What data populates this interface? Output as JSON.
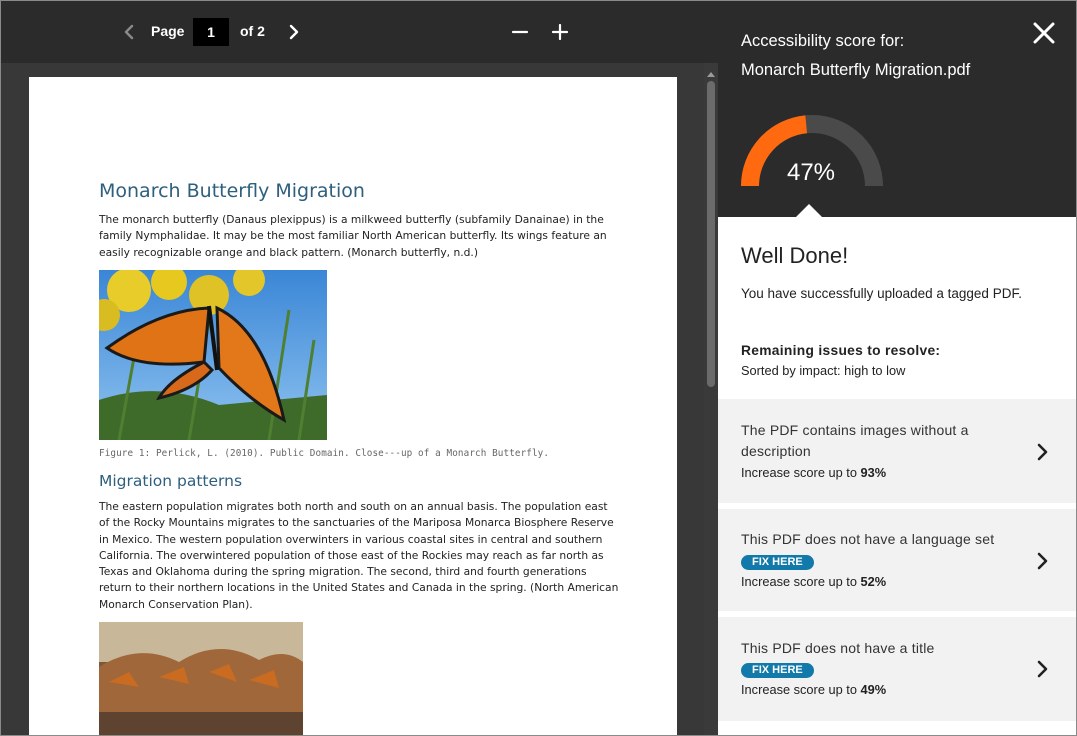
{
  "toolbar": {
    "page_label": "Page",
    "page_value": "1",
    "of_label": "of 2"
  },
  "document": {
    "title": "Monarch Butterfly Migration",
    "para1": "The monarch butterfly (Danaus plexippus) is a milkweed butterfly (subfamily Danainae) in the family Nymphalidae. It may be the most familiar North American butterfly. Its wings feature an easily recognizable orange and black pattern. (Monarch  butterfly, n.d.)",
    "caption": "Figure 1: Perlick, L. (2010). Public Domain. Close---up of a Monarch Butterfly.",
    "heading2": "Migration patterns",
    "para2": "The eastern population migrates both north and south on an annual basis. The population east of the Rocky Mountains migrates to the sanctuaries of the Mariposa Monarca Biosphere Reserve in Mexico. The western population overwinters in various coastal sites in central and southern California. The overwintered population of those east of the Rockies may reach as far north as Texas and Oklahoma during the spring migration. The second, third and fourth generations return to their northern locations in the United States and Canada in the spring.  (North American Monarch Conservation Plan)."
  },
  "panel": {
    "score_label": "Accessibility score for:",
    "file_name": "Monarch Butterfly Migration.pdf",
    "score_percent": 47,
    "score_text": "47%",
    "heading": "Well Done!",
    "message": "You have successfully uploaded a tagged PDF.",
    "remaining_label": "Remaining issues to resolve:",
    "sorted_label": "Sorted by impact: high to low",
    "issues": [
      {
        "title": "The PDF contains images without a description",
        "score_prefix": "Increase score up to",
        "score_value": "93%"
      },
      {
        "title": "This PDF does not have a language set",
        "badge": "FIX HERE",
        "score_prefix": "Increase score up to",
        "score_value": "52%"
      },
      {
        "title": "This PDF does not have a title",
        "badge": "FIX HERE",
        "score_prefix": "Increase score up to",
        "score_value": "49%"
      }
    ]
  },
  "colors": {
    "gauge_fill": "#ff6a10",
    "gauge_track": "#4a4a4a",
    "badge": "#117aaa",
    "heading_blue": "#2e5f7e"
  },
  "icons": {
    "prev": "chevron-left-icon",
    "next": "chevron-right-icon",
    "zoom_out": "minus-icon",
    "zoom_in": "plus-icon",
    "close": "close-icon",
    "issue_arrow": "chevron-right-icon"
  }
}
